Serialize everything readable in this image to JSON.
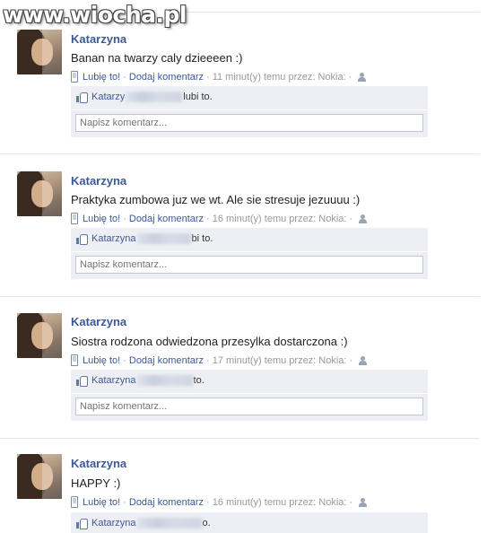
{
  "watermark": "www.wiocha.pl",
  "stories": [
    {
      "author": "Katarzyna",
      "message": "Banan na twarzy caly dzieeeen :)",
      "like_label": "Lubię to!",
      "comment_label": "Dodaj komentarz",
      "time_text": "11 minut(y) temu przez: Nokia:",
      "liker": "Katarzy",
      "likes_suffix": "lubi to.",
      "comment_placeholder": "Napisz komentarz..."
    },
    {
      "author": "Katarzyna",
      "message": "Praktyka zumbowa juz we wt. Ale sie stresuje jezuuuu :)",
      "like_label": "Lubię to!",
      "comment_label": "Dodaj komentarz",
      "time_text": "16 minut(y) temu przez: Nokia:",
      "liker": "Katarzyna",
      "likes_suffix": "bi to.",
      "comment_placeholder": "Napisz komentarz..."
    },
    {
      "author": "Katarzyna",
      "message": "Siostra rodzona odwiedzona przesylka dostarczona :)",
      "like_label": "Lubię to!",
      "comment_label": "Dodaj komentarz",
      "time_text": "17 minut(y) temu przez: Nokia:",
      "liker": "Katarzyna",
      "likes_suffix": "to.",
      "comment_placeholder": "Napisz komentarz..."
    },
    {
      "author": "Katarzyna",
      "message": "HAPPY :)",
      "like_label": "Lubię to!",
      "comment_label": "Dodaj komentarz",
      "time_text": "16 minut(y) temu przez: Nokia:",
      "liker": "Katarzyna",
      "likes_suffix": "o.",
      "comment_placeholder": ""
    }
  ],
  "colors": {
    "link": "#3b5998",
    "ufi_background": "#edeff4",
    "meta_text": "#999999"
  }
}
